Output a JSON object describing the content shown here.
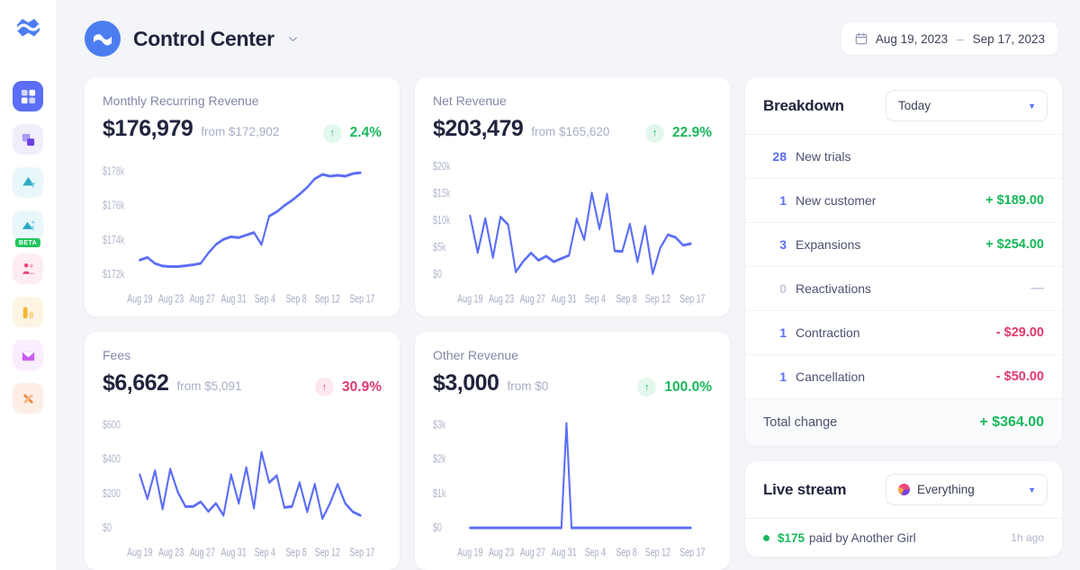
{
  "sidebar": {
    "logo": "baremetrics-logo",
    "items": [
      {
        "name": "dashboard",
        "icon": "grid-icon",
        "active": true
      },
      {
        "name": "segmentation",
        "icon": "layers-icon",
        "active": false
      },
      {
        "name": "forecast",
        "icon": "triangle-icon",
        "active": false
      },
      {
        "name": "forecast-ai",
        "icon": "triangle-sparkle-icon",
        "active": false,
        "badge": "BETA"
      },
      {
        "name": "customers",
        "icon": "people-icon",
        "active": false
      },
      {
        "name": "reports",
        "icon": "bar-chart-icon",
        "active": false
      },
      {
        "name": "messaging",
        "icon": "envelope-icon",
        "active": false
      },
      {
        "name": "tools",
        "icon": "wrench-icon",
        "active": false
      }
    ]
  },
  "header": {
    "title": "Control Center",
    "dropdown_icon": "chevron-down-icon",
    "date_range": {
      "icon": "calendar-icon",
      "start": "Aug 19, 2023",
      "separator": "–",
      "end": "Sep 17, 2023"
    }
  },
  "metrics": [
    {
      "label": "Monthly Recurring Revenue",
      "value": "$176,979",
      "from": "from $172,902",
      "delta": "2.4%",
      "direction": "up",
      "tone": "green"
    },
    {
      "label": "Net Revenue",
      "value": "$203,479",
      "from": "from $165,620",
      "delta": "22.9%",
      "direction": "up",
      "tone": "green"
    },
    {
      "label": "Fees",
      "value": "$6,662",
      "from": "from $5,091",
      "delta": "30.9%",
      "direction": "up",
      "tone": "pink"
    },
    {
      "label": "Other Revenue",
      "value": "$3,000",
      "from": "from $0",
      "delta": "100.0%",
      "direction": "up",
      "tone": "green"
    }
  ],
  "chart_data": [
    {
      "type": "line",
      "title": "Monthly Recurring Revenue",
      "xlabel": "",
      "ylabel": "",
      "grid": false,
      "legend": "none",
      "line_color": "#5b6ef5",
      "ylim": [
        171000,
        178800
      ],
      "yticks": [
        "$172k",
        "$174k",
        "$176k",
        "$178k"
      ],
      "ytick_values": [
        172000,
        174000,
        176000,
        178000
      ],
      "xticks": [
        "Aug 19",
        "Aug 23",
        "Aug 27",
        "Aug 31",
        "Sep 4",
        "Sep 8",
        "Sep 12",
        "Sep 17"
      ],
      "x": [
        "Aug 19",
        "Aug 20",
        "Aug 21",
        "Aug 22",
        "Aug 23",
        "Aug 24",
        "Aug 25",
        "Aug 26",
        "Aug 27",
        "Aug 28",
        "Aug 29",
        "Aug 30",
        "Aug 31",
        "Sep 1",
        "Sep 2",
        "Sep 3",
        "Sep 4",
        "Sep 5",
        "Sep 6",
        "Sep 7",
        "Sep 8",
        "Sep 9",
        "Sep 10",
        "Sep 11",
        "Sep 12",
        "Sep 13",
        "Sep 14",
        "Sep 15",
        "Sep 16",
        "Sep 17"
      ],
      "values": [
        172900,
        173050,
        172700,
        172550,
        172520,
        172520,
        172560,
        172620,
        172700,
        173300,
        173800,
        174100,
        174250,
        174200,
        174350,
        174500,
        173800,
        175450,
        175700,
        176050,
        176350,
        176700,
        177100,
        177600,
        177850,
        177750,
        177800,
        177750,
        177900,
        177950
      ]
    },
    {
      "type": "line",
      "title": "Net Revenue",
      "xlabel": "",
      "ylabel": "",
      "grid": false,
      "legend": "none",
      "line_color": "#5b6ef5",
      "ylim": [
        0,
        21000
      ],
      "yticks": [
        "$0",
        "$5k",
        "$10k",
        "$15k",
        "$20k"
      ],
      "ytick_values": [
        0,
        5000,
        10000,
        15000,
        20000
      ],
      "xticks": [
        "Aug 19",
        "Aug 23",
        "Aug 27",
        "Aug 31",
        "Sep 4",
        "Sep 8",
        "Sep 12",
        "Sep 17"
      ],
      "x": [
        "Aug 19",
        "Aug 20",
        "Aug 21",
        "Aug 22",
        "Aug 23",
        "Aug 24",
        "Aug 25",
        "Aug 26",
        "Aug 27",
        "Aug 28",
        "Aug 29",
        "Aug 30",
        "Aug 31",
        "Sep 1",
        "Sep 2",
        "Sep 3",
        "Sep 4",
        "Sep 5",
        "Sep 6",
        "Sep 7",
        "Sep 8",
        "Sep 9",
        "Sep 10",
        "Sep 11",
        "Sep 12",
        "Sep 13",
        "Sep 14",
        "Sep 15",
        "Sep 16",
        "Sep 17"
      ],
      "values": [
        11500,
        4700,
        10100,
        3800,
        12000,
        10600,
        1800,
        4000,
        5300,
        3700,
        4500,
        3600,
        4200,
        4800,
        10000,
        6200,
        14800,
        8200,
        14600,
        5000,
        4900,
        9400,
        3600,
        9000,
        1700,
        5700,
        8100,
        7600,
        6000,
        6300
      ]
    },
    {
      "type": "line",
      "title": "Fees",
      "xlabel": "",
      "ylabel": "",
      "grid": false,
      "legend": "none",
      "line_color": "#5b6ef5",
      "ylim": [
        0,
        640
      ],
      "yticks": [
        "$0",
        "$200",
        "$400",
        "$600"
      ],
      "ytick_values": [
        0,
        200,
        400,
        600
      ],
      "xticks": [
        "Aug 19",
        "Aug 23",
        "Aug 27",
        "Aug 31",
        "Sep 4",
        "Sep 8",
        "Sep 12",
        "Sep 17"
      ],
      "x": [
        "Aug 19",
        "Aug 20",
        "Aug 21",
        "Aug 22",
        "Aug 23",
        "Aug 24",
        "Aug 25",
        "Aug 26",
        "Aug 27",
        "Aug 28",
        "Aug 29",
        "Aug 30",
        "Aug 31",
        "Sep 1",
        "Sep 2",
        "Sep 3",
        "Sep 4",
        "Sep 5",
        "Sep 6",
        "Sep 7",
        "Sep 8",
        "Sep 9",
        "Sep 10",
        "Sep 11",
        "Sep 12",
        "Sep 13",
        "Sep 14",
        "Sep 15",
        "Sep 16",
        "Sep 17"
      ],
      "values": [
        330,
        190,
        350,
        110,
        385,
        240,
        150,
        150,
        180,
        120,
        175,
        100,
        330,
        175,
        360,
        140,
        455,
        265,
        500,
        160,
        165,
        300,
        130,
        290,
        80,
        175,
        290,
        175,
        120,
        100
      ]
    },
    {
      "type": "line",
      "title": "Other Revenue",
      "xlabel": "",
      "ylabel": "",
      "grid": false,
      "legend": "none",
      "line_color": "#5b6ef5",
      "ylim": [
        0,
        3200
      ],
      "yticks": [
        "$0",
        "$1k",
        "$2k",
        "$3k"
      ],
      "ytick_values": [
        0,
        1000,
        2000,
        3000
      ],
      "xticks": [
        "Aug 19",
        "Aug 23",
        "Aug 27",
        "Aug 31",
        "Sep 4",
        "Sep 8",
        "Sep 12",
        "Sep 17"
      ],
      "x": [
        "Aug 19",
        "Aug 20",
        "Aug 21",
        "Aug 22",
        "Aug 23",
        "Aug 24",
        "Aug 25",
        "Aug 26",
        "Aug 27",
        "Aug 28",
        "Aug 29",
        "Aug 30",
        "Aug 31",
        "Sep 1",
        "Sep 2",
        "Sep 3",
        "Sep 4",
        "Sep 5",
        "Sep 6",
        "Sep 7",
        "Sep 8",
        "Sep 9",
        "Sep 10",
        "Sep 11",
        "Sep 12",
        "Sep 13",
        "Sep 14",
        "Sep 15",
        "Sep 16",
        "Sep 17"
      ],
      "values": [
        0,
        0,
        0,
        0,
        0,
        0,
        0,
        0,
        0,
        0,
        0,
        0,
        0,
        3000,
        0,
        0,
        0,
        0,
        0,
        0,
        0,
        0,
        0,
        0,
        0,
        0,
        0,
        0,
        0,
        0
      ]
    }
  ],
  "breakdown": {
    "title": "Breakdown",
    "filter_value": "Today",
    "rows": [
      {
        "count": "28",
        "name": "New trials",
        "amount": "",
        "tone": "none"
      },
      {
        "count": "1",
        "name": "New customer",
        "amount": "+ $189.00",
        "tone": "green"
      },
      {
        "count": "3",
        "name": "Expansions",
        "amount": "+ $254.00",
        "tone": "green"
      },
      {
        "count": "0",
        "name": "Reactivations",
        "amount": "—",
        "tone": "muted"
      },
      {
        "count": "1",
        "name": "Contraction",
        "amount": "- $29.00",
        "tone": "red"
      },
      {
        "count": "1",
        "name": "Cancellation",
        "amount": "- $50.00",
        "tone": "red"
      }
    ],
    "total_label": "Total change",
    "total_amount": "+ $364.00"
  },
  "live_stream": {
    "title": "Live stream",
    "filter_value": "Everything",
    "events": [
      {
        "amount": "$175",
        "text": "paid by Another Girl",
        "time": "1h ago"
      }
    ]
  },
  "colors": {
    "accent": "#5b6ef5",
    "positive": "#18b85a",
    "negative": "#e03a6d",
    "page_bg": "#f4f5f9",
    "card_bg": "#ffffff"
  }
}
